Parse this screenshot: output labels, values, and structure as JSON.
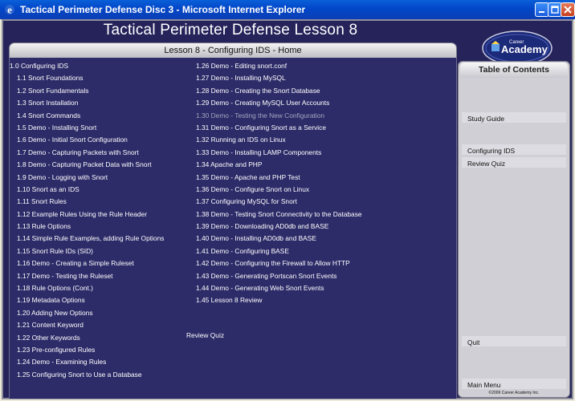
{
  "window": {
    "title": "Tactical Perimeter Defense Disc 3 - Microsoft Internet Explorer"
  },
  "header": {
    "title": "Tactical Perimeter Defense Lesson 8",
    "subtitle": "Lesson 8 - Configuring IDS - Home"
  },
  "logo": {
    "text": "Academy",
    "small": "Career"
  },
  "lessons_left": [
    {
      "label": "1.0 Configuring IDS",
      "indent": false,
      "visited": false
    },
    {
      "label": "1.1 Snort Foundations",
      "indent": true,
      "visited": false
    },
    {
      "label": "1.2 Snort Fundamentals",
      "indent": true,
      "visited": false
    },
    {
      "label": "1.3 Snort Installation",
      "indent": true,
      "visited": false
    },
    {
      "label": "1.4 Snort Commands",
      "indent": true,
      "visited": false
    },
    {
      "label": "1.5 Demo - Installing Snort",
      "indent": true,
      "visited": false
    },
    {
      "label": "1.6 Demo - Initial Snort Configuration",
      "indent": true,
      "visited": false
    },
    {
      "label": "1.7 Demo - Capturing Packets with Snort",
      "indent": true,
      "visited": false
    },
    {
      "label": "1.8 Demo - Capturing Packet Data with Snort",
      "indent": true,
      "visited": false
    },
    {
      "label": "1.9 Demo - Logging with Snort",
      "indent": true,
      "visited": false
    },
    {
      "label": "1.10 Snort as an IDS",
      "indent": true,
      "visited": false
    },
    {
      "label": "1.11 Snort Rules",
      "indent": true,
      "visited": false
    },
    {
      "label": "1.12 Example Rules Using the Rule Header",
      "indent": true,
      "visited": false
    },
    {
      "label": "1.13 Rule Options",
      "indent": true,
      "visited": false
    },
    {
      "label": "1.14 Simple Rule Examples, adding Rule Options",
      "indent": true,
      "visited": false
    },
    {
      "label": "1.15 Snort Rule IDs (SID)",
      "indent": true,
      "visited": false
    },
    {
      "label": "1.16 Demo - Creating a Simple Ruleset",
      "indent": true,
      "visited": false
    },
    {
      "label": "1.17 Demo - Testing the Ruleset",
      "indent": true,
      "visited": false
    },
    {
      "label": "1.18 Rule Options (Cont.)",
      "indent": true,
      "visited": false
    },
    {
      "label": "1.19 Metadata Options",
      "indent": true,
      "visited": false
    },
    {
      "label": "1.20 Adding New Options",
      "indent": true,
      "visited": false
    },
    {
      "label": "1.21 Content Keyword",
      "indent": true,
      "visited": false
    },
    {
      "label": "1.22 Other Keywords",
      "indent": true,
      "visited": false
    },
    {
      "label": "1.23 Pre-configured Rules",
      "indent": true,
      "visited": false
    },
    {
      "label": "1.24 Demo - Examining Rules",
      "indent": true,
      "visited": false
    },
    {
      "label": "1.25 Configuring Snort to Use a Database",
      "indent": true,
      "visited": false
    }
  ],
  "lessons_right": [
    {
      "label": "1.26 Demo - Editing snort.conf",
      "visited": false
    },
    {
      "label": "1.27 Demo - Installing MySQL",
      "visited": false
    },
    {
      "label": "1.28 Demo - Creating the Snort Database",
      "visited": false
    },
    {
      "label": "1.29 Demo - Creating MySQL User Accounts",
      "visited": false
    },
    {
      "label": "1.30 Demo - Testing the New Configuration",
      "visited": true
    },
    {
      "label": "1.31 Demo - Configuring Snort as a Service",
      "visited": false
    },
    {
      "label": "1.32 Running an IDS on Linux",
      "visited": false
    },
    {
      "label": "1.33 Demo - Installing LAMP Components",
      "visited": false
    },
    {
      "label": "1.34 Apache and PHP",
      "visited": false
    },
    {
      "label": "1.35 Demo - Apache and PHP Test",
      "visited": false
    },
    {
      "label": "1.36 Demo - Configure Snort on Linux",
      "visited": false
    },
    {
      "label": "1.37 Configuring MySQL for Snort",
      "visited": false
    },
    {
      "label": "1.38 Demo - Testing Snort Connectivity to the Database",
      "visited": false
    },
    {
      "label": "1.39 Demo - Downloading AD0db and BASE",
      "visited": false
    },
    {
      "label": "1.40 Demo - Installing AD0db and BASE",
      "visited": false
    },
    {
      "label": "1.41 Demo - Configuring BASE",
      "visited": false
    },
    {
      "label": "1.42 Demo - Configuring the Firewall to Allow HTTP",
      "visited": false
    },
    {
      "label": "1.43 Demo - Generating Portscan Snort Events",
      "visited": false
    },
    {
      "label": "1.44 Demo - Generating Web Snort Events",
      "visited": false
    },
    {
      "label": "1.45 Lesson 8 Review",
      "visited": false
    }
  ],
  "main": {
    "review_quiz": "Review Quiz"
  },
  "sidebar": {
    "toc_title": "Table of Contents",
    "study_guide": "Study Guide",
    "configuring_ids": "Configuring IDS",
    "review_quiz": "Review Quiz",
    "quit": "Quit",
    "main_menu": "Main Menu",
    "copyright": "©2006 Career Academy Inc."
  },
  "colors": {
    "background": "#25235a",
    "panel": "#2d2b68",
    "text": "#ffffff",
    "visited_text": "#a6a6bf",
    "sidebar": "#cfcfd5",
    "titlebar": "#0a5fd8"
  }
}
